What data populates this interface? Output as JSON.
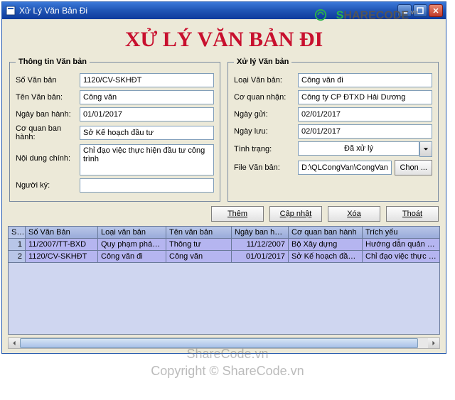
{
  "watermark": {
    "brand_prefix": "S",
    "brand_rest": "HARECODE",
    "brand_suffix": ".vn",
    "line1": "ShareCode.vn",
    "line2": "Copyright © ShareCode.vn"
  },
  "window": {
    "title": "Xử Lý Văn Bản Đi"
  },
  "main_title": "XỬ LÝ VĂN BẢN ĐI",
  "group_left": {
    "legend": "Thông tin Văn bản",
    "fields": {
      "so_vb_label": "Số Văn bản",
      "so_vb": "1120/CV-SKHĐT",
      "ten_vb_label": "Tên Văn bản:",
      "ten_vb": "Công văn",
      "ngay_bh_label": "Ngày ban hành:",
      "ngay_bh": "01/01/2017",
      "cq_bh_label": "Cơ quan ban hành:",
      "cq_bh": "Sở Kế hoạch đầu tư",
      "nd_label": "Nội dung chính:",
      "nd": "Chỉ đạo việc thực hiện đầu tư công trình",
      "nguoi_ky_label": "Người ký:",
      "nguoi_ky": ""
    }
  },
  "group_right": {
    "legend": "Xử lý Văn bản",
    "fields": {
      "loai_vb_label": "Loại Văn bản:",
      "loai_vb": "Công văn đi",
      "cq_nhan_label": "Cơ quan nhận:",
      "cq_nhan": "Công ty CP ĐTXD Hải Dương",
      "ngay_gui_label": "Ngày gửi:",
      "ngay_gui": "02/01/2017",
      "ngay_luu_label": "Ngày lưu:",
      "ngay_luu": "02/01/2017",
      "tinh_trang_label": "Tình trạng:",
      "tinh_trang": "Đã xử lý",
      "file_vb_label": "File Văn bản:",
      "file_vb": "D:\\QLCongVan\\CongVanDi\\Cong va",
      "chon_label": "Chọn ..."
    }
  },
  "buttons": {
    "them": "Thêm",
    "capnhat": "Cập nhật",
    "xoa": "Xóa",
    "thoat": "Thoát"
  },
  "grid": {
    "headers": {
      "stt": "STT",
      "sovb": "Số Văn Bản",
      "loai": "Loại văn bản",
      "ten": "Tên văn bản",
      "ngay": "Ngày ban hành",
      "cq": "Cơ quan ban hành",
      "ty": "Trích yếu"
    },
    "rows": [
      {
        "stt": "1",
        "sovb": "11/2007/TT-BXD",
        "loai": "Quy phạm pháp luật",
        "ten": "Thông tư",
        "ngay": "11/12/2007",
        "cq": "Bộ Xây dựng",
        "ty": "Hướng dẫn quản lý vật liệu xây"
      },
      {
        "stt": "2",
        "sovb": "1120/CV-SKHĐT",
        "loai": "Công văn đi",
        "ten": "Công văn",
        "ngay": "01/01/2017",
        "cq": "Sở Kế hoạch đầu tư",
        "ty": "Chỉ đạo việc thực hiện đầu tư"
      }
    ]
  }
}
